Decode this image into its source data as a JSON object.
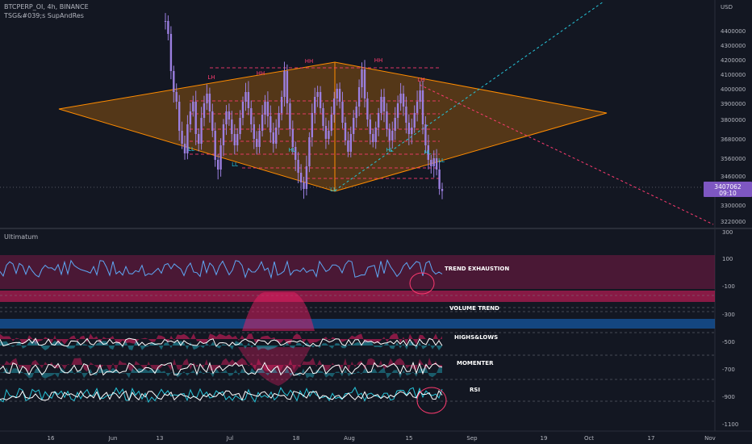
{
  "header": {
    "symbol": "BTCPERP_OI, 4h, BINANCE",
    "study": "TSG&#039;s SupAndRes"
  },
  "price_panel": {
    "currency": "USD",
    "price_ticks": [
      "4400000",
      "4300000",
      "4200000",
      "4100000",
      "4000000",
      "3900000",
      "3800000",
      "3680000",
      "3560000",
      "3460000",
      "3300000",
      "3220000"
    ],
    "last_price": "3407062",
    "countdown": "09:10",
    "pivot_labels": [
      "LH",
      "HH",
      "HH",
      "HH",
      "LH",
      "LL",
      "LL",
      "HL",
      "LL",
      "HL",
      "HL",
      "LL"
    ],
    "colors": {
      "candle": "#9b7fe0",
      "wedge": "#ff8c00",
      "pivot_high": "#ff3b70",
      "pivot_low": "#26c6da",
      "trend_up": "#26c6da",
      "trend_down": "#ff3b70"
    }
  },
  "oscillator_panel": {
    "title": "Ultimatum",
    "ticks": [
      "300",
      "100",
      "-100",
      "-300",
      "-500",
      "-700",
      "-900",
      "-1100"
    ],
    "section_labels": [
      "TREND EXHAUSTION",
      "VOLUME TREND",
      "HIGHS&LOWS",
      "MOMENTER",
      "RSI"
    ]
  },
  "time_axis": {
    "labels": [
      "16",
      "Jun",
      "13",
      "Jul",
      "18",
      "Aug",
      "15",
      "Sep",
      "19",
      "Oct",
      "17",
      "Nov"
    ]
  },
  "chart_data": {
    "type": "line",
    "title": "BTCPERP_OI, 4h, BINANCE",
    "y_unit": "USD",
    "ylim": [
      3150000,
      4450000
    ],
    "x_ticks": [
      "16",
      "Jun",
      "13",
      "Jul",
      "18",
      "Aug",
      "15",
      "Sep",
      "19",
      "Oct",
      "17",
      "Nov"
    ],
    "series": [
      {
        "name": "BTCPERP_OI",
        "x_index_range": [
          0,
          100
        ],
        "values": [
          4460000,
          4380000,
          4150000,
          4020000,
          3960000,
          3780000,
          3700000,
          3640000,
          3820000,
          3900000,
          3960000,
          3760000,
          3700000,
          3860000,
          3950000,
          4010000,
          3900000,
          3780000,
          3600000,
          3540000,
          3690000,
          3820000,
          3900000,
          3850000,
          3760000,
          3690000,
          3760000,
          3860000,
          3960000,
          4020000,
          3920000,
          3820000,
          3730000,
          3680000,
          3780000,
          3880000,
          3960000,
          3870000,
          3770000,
          3700000,
          3800000,
          3890000,
          3990000,
          4150000,
          3950000,
          3790000,
          3680000,
          3600000,
          3520000,
          3460000,
          3420000,
          3560000,
          3740000,
          3890000,
          3990000,
          4020000,
          3920000,
          3810000,
          3730000,
          3780000,
          3880000,
          3980000,
          4040000,
          3960000,
          3830000,
          3720000,
          3650000,
          3760000,
          3860000,
          3930000,
          4050000,
          4160000,
          3980000,
          3850000,
          3760000,
          3710000,
          3800000,
          3890000,
          3990000,
          3900000,
          3790000,
          3720000,
          3780000,
          3860000,
          3950000,
          4010000,
          3930000,
          3830000,
          3760000,
          3800000,
          3890000,
          3960000,
          4030000,
          3820000,
          3690000,
          3600000,
          3560000,
          3610000,
          3540000,
          3420000,
          3407062
        ]
      }
    ],
    "oscillator": {
      "name": "Ultimatum",
      "y_ticks": [
        300,
        100,
        -100,
        -300,
        -500,
        -700,
        -900,
        -1100
      ],
      "sections": [
        "TREND EXHAUSTION",
        "VOLUME TREND",
        "HIGHS&LOWS",
        "MOMENTER",
        "RSI"
      ]
    }
  }
}
